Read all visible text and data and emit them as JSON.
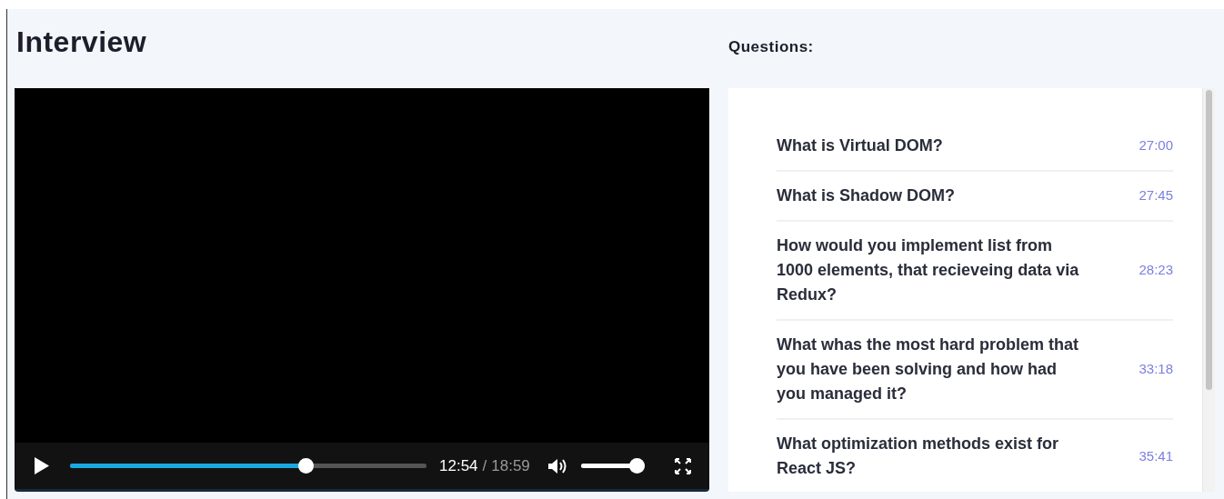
{
  "title": "Interview",
  "video": {
    "playing": false,
    "progress": {
      "level": 0.67
    },
    "current_time": "12:54",
    "separator": "/",
    "duration": "18:59",
    "muted": false,
    "volume": {
      "level": 1
    }
  },
  "questions_label": "Questions:",
  "questions": [
    {
      "text": "What is Virtual DOM?",
      "time": "27:00"
    },
    {
      "text": "What is Shadow DOM?",
      "time": "27:45"
    },
    {
      "text": "How would you implement list from 1000 elements, that recieveing data via Redux?",
      "time": "28:23"
    },
    {
      "text": "What whas the most hard problem that you have been solving and how had you managed it?",
      "time": "33:18"
    },
    {
      "text": "What optimization methods exist for React JS?",
      "time": "35:41"
    }
  ]
}
